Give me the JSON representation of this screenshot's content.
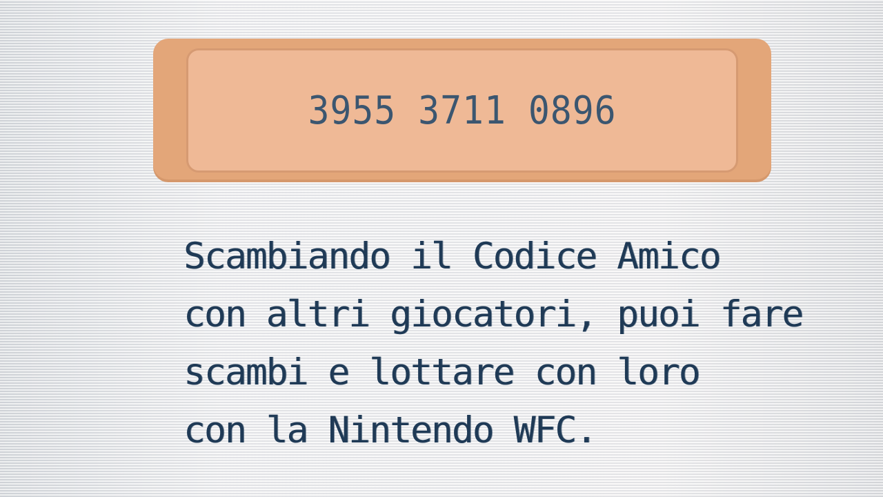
{
  "friend_code": {
    "value": "3955 3711 0896"
  },
  "message": {
    "lines": [
      "Scambiando il Codice Amico",
      "con altri giocatori, puoi fare",
      "scambi e lottare con loro",
      "con la Nintendo WFC."
    ]
  }
}
